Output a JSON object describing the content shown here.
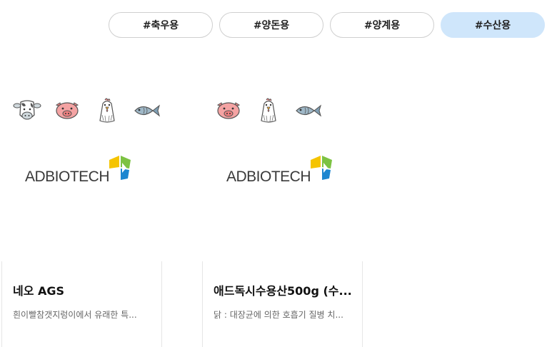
{
  "tabs": [
    {
      "label": "#축우용",
      "active": false
    },
    {
      "label": "#양돈용",
      "active": false
    },
    {
      "label": "#양계용",
      "active": false
    },
    {
      "label": "#수산용",
      "active": true
    }
  ],
  "products": [
    {
      "animal_icons": [
        "cow-icon",
        "pig-icon",
        "chicken-icon",
        "fish-icon"
      ],
      "brand_logo": "ADBIOTECH",
      "title": "네오 AGS",
      "description": "흰이빨참갯지렁이에서 유래한 특..."
    },
    {
      "animal_icons": [
        "pig-icon",
        "chicken-icon",
        "fish-icon"
      ],
      "brand_logo": "ADBIOTECH",
      "title": "애드독시수용산500g (수...",
      "description": "닭 : 대장균에 의한 호흡기 질병 치..."
    }
  ],
  "colors": {
    "active_tab": "#cfe6fb",
    "logo_yellow": "#f5c400",
    "logo_green": "#7cc242",
    "logo_blue": "#1d86d0",
    "pig_pink": "#f08080",
    "fish_blue": "#7f9fb5"
  }
}
